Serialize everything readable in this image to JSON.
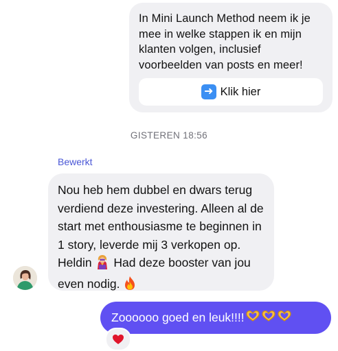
{
  "shared_card": {
    "text": "In Mini Launch Method neem ik je mee in welke stappen ik en mijn klanten volgen, inclusief voorbeelden van posts en meer!",
    "button_icon": "arrow-right-emoji",
    "button_label": "Klik hier"
  },
  "timestamp": "GISTEREN 18:56",
  "incoming": {
    "edited_label": "Bewerkt",
    "text_part1": "Nou heb hem dubbel en dwars terug verdiend deze investering. Alleen al de start met enthousiasme te beginnen in 1 story, leverde mij 3 verkopen op. Heldin ",
    "emoji1": "superhero-woman-emoji",
    "text_part2": " Had deze booster van jou even nodig. ",
    "emoji2": "fire-emoji"
  },
  "outgoing": {
    "text": "Zoooooo goed en leuk!!!!",
    "emojis": [
      "heart-hands-emoji",
      "heart-hands-emoji",
      "heart-hands-emoji"
    ],
    "bubble_color": "#6050f2"
  },
  "reaction": {
    "icon": "red-heart-emoji",
    "color": "#e0152b"
  }
}
